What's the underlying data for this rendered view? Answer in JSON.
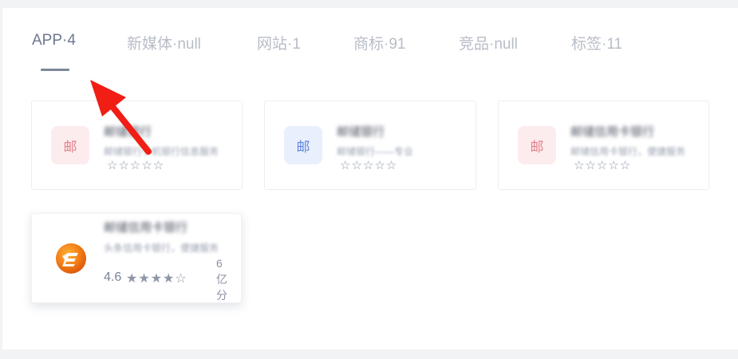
{
  "tabs": [
    {
      "label": "APP·4",
      "active": true
    },
    {
      "label": "新媒体·null",
      "active": false
    },
    {
      "label": "网站·1",
      "active": false
    },
    {
      "label": "商标·91",
      "active": false
    },
    {
      "label": "竞品·null",
      "active": false
    },
    {
      "label": "标签·11",
      "active": false
    }
  ],
  "cards": [
    {
      "logo_text": "邮",
      "logo_color": "red",
      "name": "邮储银行",
      "desc": "邮储银行手机银行信息服务",
      "stars": "☆☆☆☆☆"
    },
    {
      "logo_text": "邮",
      "logo_color": "blue",
      "name": "邮储银行",
      "desc": "邮储银行——专业",
      "stars": "☆☆☆☆☆"
    },
    {
      "logo_text": "邮",
      "logo_color": "red",
      "name": "邮储信用卡银行",
      "desc": "邮储信用卡银行，便捷服务",
      "stars": "☆☆☆☆☆"
    },
    {
      "logo_icon": "app-logo-icon",
      "name": "邮储信用卡银行",
      "desc": "头条信用卡银行，便捷服务",
      "rating": "4.6",
      "stars": "★★★★☆",
      "side_text": "6亿分"
    }
  ],
  "colors": {
    "active_tab": "#6d7891",
    "inactive_tab": "#b8bdc7",
    "arrow": "#f01e14",
    "logo_orange": "#f07818"
  }
}
